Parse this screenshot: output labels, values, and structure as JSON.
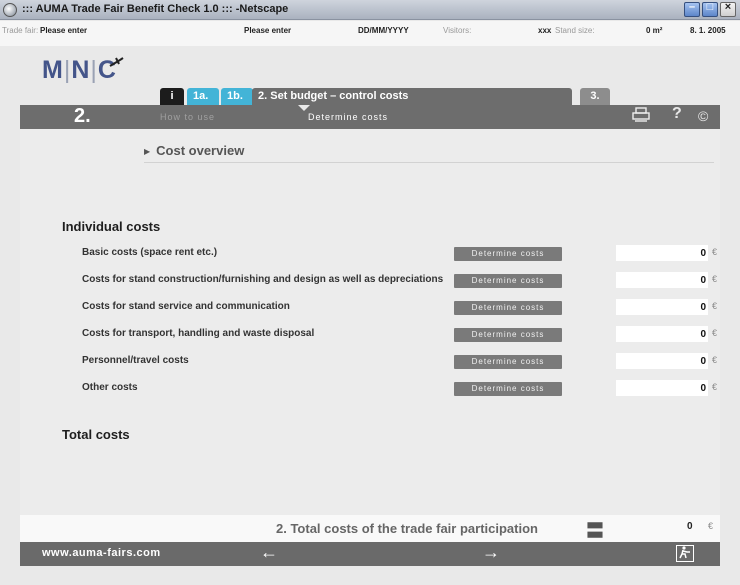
{
  "window": {
    "title": "::: AUMA Trade Fair Benefit Check 1.0 ::: -Netscape"
  },
  "info": {
    "trade_fair_label": "Trade fair:",
    "trade_fair_value": "Please enter",
    "city_value": "Please enter",
    "date_value": "DD/MM/YYYY",
    "visitors_label": "Visitors:",
    "visitors_value": "xxx",
    "stand_label": "Stand size:",
    "stand_value": "0 m²",
    "current_date": "8. 1. 2005"
  },
  "logo": {
    "m": "M",
    "n": "N",
    "c": "C",
    "bar": "|"
  },
  "tabs": {
    "info": "i",
    "t1a": "1a.",
    "t1b": "1b.",
    "active": "2.   Set budget – control costs",
    "t3": "3."
  },
  "stepbar": {
    "number": "2.",
    "how_to_use": "How to use",
    "determine": "Determine costs"
  },
  "content": {
    "overview": "Cost overview",
    "individual_title": "Individual costs",
    "total_title": "Total costs",
    "button_label": "Determine costs",
    "currency": "€",
    "rows": [
      {
        "label": "Basic costs (space rent etc.)",
        "value": "0"
      },
      {
        "label": "Costs for stand construction/furnishing and design as well as depreciations",
        "value": "0"
      },
      {
        "label": "Costs for stand service and communication",
        "value": "0"
      },
      {
        "label": "Costs for transport, handling and waste disposal",
        "value": "0"
      },
      {
        "label": "Personnel/travel costs",
        "value": "0"
      },
      {
        "label": "Other costs",
        "value": "0"
      }
    ]
  },
  "total": {
    "label": "2. Total costs of the trade fair participation",
    "value": "0",
    "currency": "€"
  },
  "footer": {
    "url": "www.auma-fairs.com"
  }
}
